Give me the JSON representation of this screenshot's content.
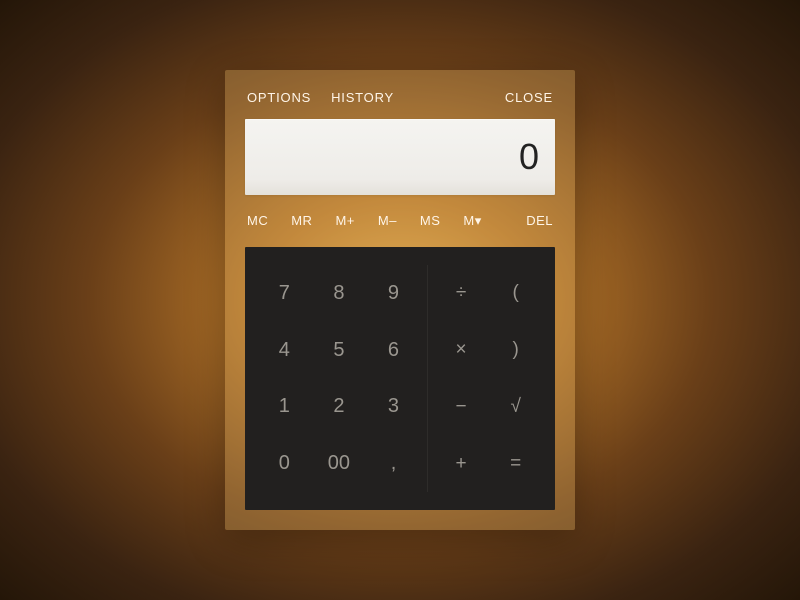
{
  "menu": {
    "options": "OPTIONS",
    "history": "HISTORY",
    "close": "CLOSE"
  },
  "display": {
    "value": "0"
  },
  "memory": {
    "mc": "MC",
    "mr": "MR",
    "mplus": "M+",
    "mminus": "M–",
    "ms": "MS",
    "mmenu": "M▾",
    "del": "DEL"
  },
  "keys": {
    "n7": "7",
    "n8": "8",
    "n9": "9",
    "n4": "4",
    "n5": "5",
    "n6": "6",
    "n1": "1",
    "n2": "2",
    "n3": "3",
    "n0": "0",
    "n00": "00",
    "dec": ",",
    "div": "÷",
    "lpar": "(",
    "mul": "×",
    "rpar": ")",
    "sub": "−",
    "sqrt": "√",
    "add": "+",
    "eq": "="
  }
}
